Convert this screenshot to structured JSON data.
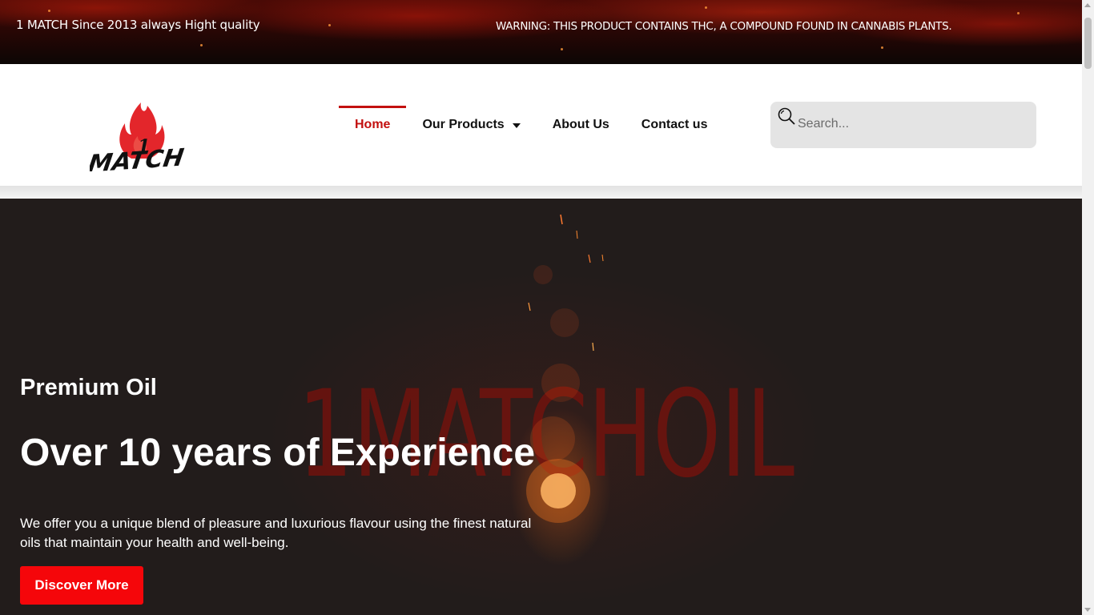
{
  "topbar": {
    "left_text": "1 MATCH Since 2013 always Hight quality",
    "right_text": "WARNING: THIS PRODUCT CONTAINS THC, A COMPOUND FOUND IN CANNABIS PLANTS."
  },
  "header": {
    "logo": {
      "number": "1",
      "wordmark": "MATCH",
      "icon": "flame-logo-icon"
    },
    "nav": [
      {
        "label": "Home",
        "active": true
      },
      {
        "label": "Our Products",
        "has_dropdown": true
      },
      {
        "label": "About Us"
      },
      {
        "label": "Contact us"
      }
    ],
    "search": {
      "placeholder": "Search...",
      "value": "",
      "icon": "search-icon"
    }
  },
  "hero": {
    "background_word": "1MATCHOIL",
    "label": "Premium Oil",
    "title": "Over 10 years of Experience",
    "text": "We offer you a unique blend of pleasure and luxurious flavour using the finest natural oils that maintain your health and well-being.",
    "button_label": "Discover More"
  },
  "colors": {
    "accent": "#c3100f",
    "button": "#f5060a",
    "hero_background": "#221c1b",
    "search_background": "#e4e4e4"
  }
}
